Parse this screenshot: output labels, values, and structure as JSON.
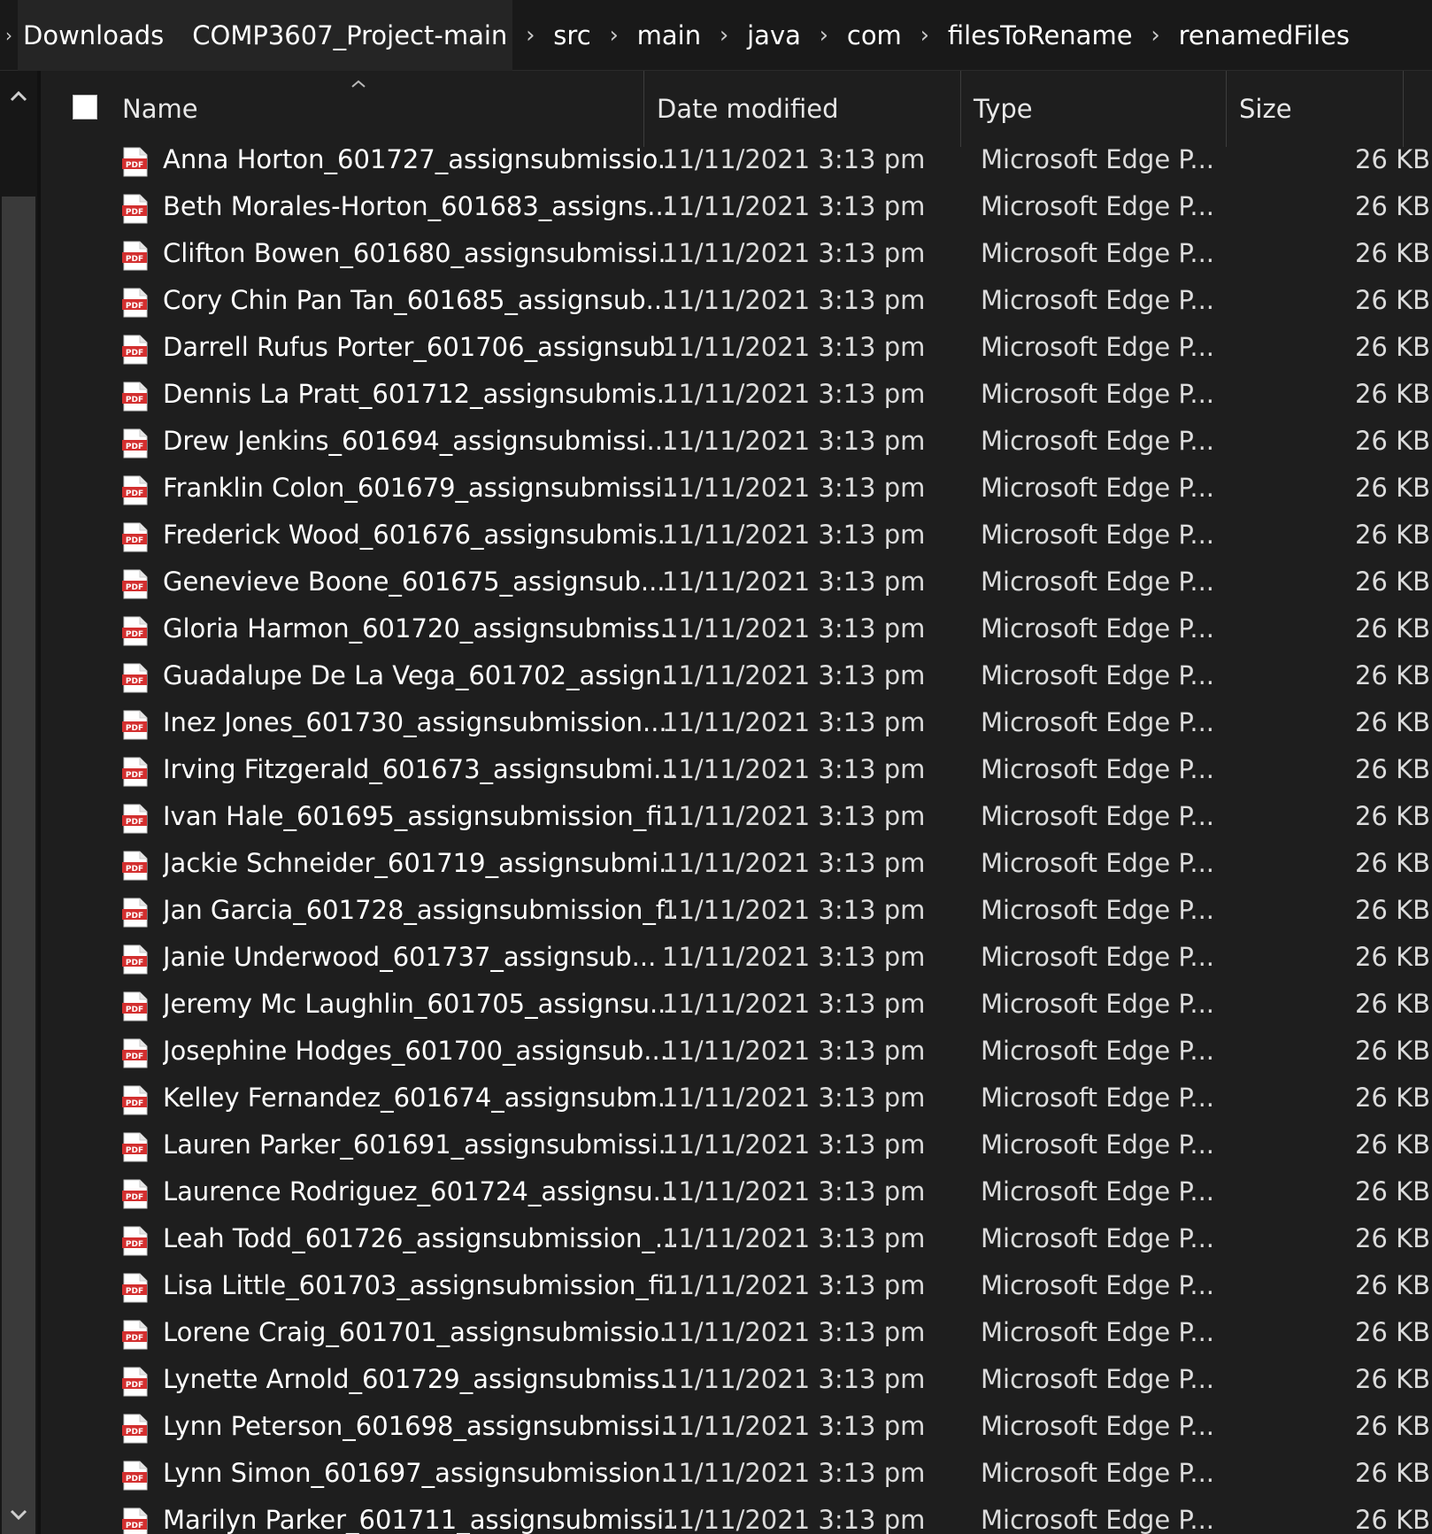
{
  "breadcrumb": [
    "Downloads",
    "COMP3607_Project-main",
    "src",
    "main",
    "java",
    "com",
    "filesToRename",
    "renamedFiles"
  ],
  "breadcrumb_separator": "›",
  "columns": {
    "name": "Name",
    "date": "Date modified",
    "type": "Type",
    "size": "Size"
  },
  "files": [
    {
      "name": "Anna Horton_601727_assignsubmissio...",
      "date": "11/11/2021 3:13 pm",
      "type": "Microsoft Edge P...",
      "size": "26 KB"
    },
    {
      "name": "Beth Morales-Horton_601683_assigns...",
      "date": "11/11/2021 3:13 pm",
      "type": "Microsoft Edge P...",
      "size": "26 KB"
    },
    {
      "name": "Clifton Bowen_601680_assignsubmissi...",
      "date": "11/11/2021 3:13 pm",
      "type": "Microsoft Edge P...",
      "size": "26 KB"
    },
    {
      "name": "Cory Chin Pan Tan_601685_assignsub...",
      "date": "11/11/2021 3:13 pm",
      "type": "Microsoft Edge P...",
      "size": "26 KB"
    },
    {
      "name": "Darrell Rufus Porter_601706_assignsub...",
      "date": "11/11/2021 3:13 pm",
      "type": "Microsoft Edge P...",
      "size": "26 KB"
    },
    {
      "name": "Dennis La Pratt_601712_assignsubmis...",
      "date": "11/11/2021 3:13 pm",
      "type": "Microsoft Edge P...",
      "size": "26 KB"
    },
    {
      "name": "Drew Jenkins_601694_assignsubmissi...",
      "date": "11/11/2021 3:13 pm",
      "type": "Microsoft Edge P...",
      "size": "26 KB"
    },
    {
      "name": "Franklin Colon_601679_assignsubmissi...",
      "date": "11/11/2021 3:13 pm",
      "type": "Microsoft Edge P...",
      "size": "26 KB"
    },
    {
      "name": "Frederick Wood_601676_assignsubmis...",
      "date": "11/11/2021 3:13 pm",
      "type": "Microsoft Edge P...",
      "size": "26 KB"
    },
    {
      "name": "Genevieve Boone_601675_assignsub...",
      "date": "11/11/2021 3:13 pm",
      "type": "Microsoft Edge P...",
      "size": "26 KB"
    },
    {
      "name": "Gloria Harmon_601720_assignsubmiss...",
      "date": "11/11/2021 3:13 pm",
      "type": "Microsoft Edge P...",
      "size": "26 KB"
    },
    {
      "name": "Guadalupe De La Vega_601702_assign...",
      "date": "11/11/2021 3:13 pm",
      "type": "Microsoft Edge P...",
      "size": "26 KB"
    },
    {
      "name": "Inez  Jones_601730_assignsubmission...",
      "date": "11/11/2021 3:13 pm",
      "type": "Microsoft Edge P...",
      "size": "26 KB"
    },
    {
      "name": "Irving Fitzgerald_601673_assignsubmi...",
      "date": "11/11/2021 3:13 pm",
      "type": "Microsoft Edge P...",
      "size": "26 KB"
    },
    {
      "name": "Ivan Hale_601695_assignsubmission_fi...",
      "date": "11/11/2021 3:13 pm",
      "type": "Microsoft Edge P...",
      "size": "26 KB"
    },
    {
      "name": "Jackie Schneider_601719_assignsubmi...",
      "date": "11/11/2021 3:13 pm",
      "type": "Microsoft Edge P...",
      "size": "26 KB"
    },
    {
      "name": "Jan Garcia_601728_assignsubmission_f...",
      "date": "11/11/2021 3:13 pm",
      "type": "Microsoft Edge P...",
      "size": "26 KB"
    },
    {
      "name": "Janie Underwood_601737_assignsub...",
      "date": "11/11/2021 3:13 pm",
      "type": "Microsoft Edge P...",
      "size": "26 KB"
    },
    {
      "name": "Jeremy Mc Laughlin_601705_assignsu...",
      "date": "11/11/2021 3:13 pm",
      "type": "Microsoft Edge P...",
      "size": "26 KB"
    },
    {
      "name": "Josephine Hodges_601700_assignsub...",
      "date": "11/11/2021 3:13 pm",
      "type": "Microsoft Edge P...",
      "size": "26 KB"
    },
    {
      "name": "Kelley Fernandez_601674_assignsubm...",
      "date": "11/11/2021 3:13 pm",
      "type": "Microsoft Edge P...",
      "size": "26 KB"
    },
    {
      "name": "Lauren Parker_601691_assignsubmissi...",
      "date": "11/11/2021 3:13 pm",
      "type": "Microsoft Edge P...",
      "size": "26 KB"
    },
    {
      "name": "Laurence Rodriguez_601724_assignsu...",
      "date": "11/11/2021 3:13 pm",
      "type": "Microsoft Edge P...",
      "size": "26 KB"
    },
    {
      "name": "Leah Todd_601726_assignsubmission_...",
      "date": "11/11/2021 3:13 pm",
      "type": "Microsoft Edge P...",
      "size": "26 KB"
    },
    {
      "name": "Lisa Little_601703_assignsubmission_fi...",
      "date": "11/11/2021 3:13 pm",
      "type": "Microsoft Edge P...",
      "size": "26 KB"
    },
    {
      "name": "Lorene Craig_601701_assignsubmissio...",
      "date": "11/11/2021 3:13 pm",
      "type": "Microsoft Edge P...",
      "size": "26 KB"
    },
    {
      "name": "Lynette Arnold_601729_assignsubmiss...",
      "date": "11/11/2021 3:13 pm",
      "type": "Microsoft Edge P...",
      "size": "26 KB"
    },
    {
      "name": "Lynn Peterson_601698_assignsubmissi...",
      "date": "11/11/2021 3:13 pm",
      "type": "Microsoft Edge P...",
      "size": "26 KB"
    },
    {
      "name": "Lynn Simon_601697_assignsubmission...",
      "date": "11/11/2021 3:13 pm",
      "type": "Microsoft Edge P...",
      "size": "26 KB"
    },
    {
      "name": "Marilyn Parker_601711_assignsubmissi...",
      "date": "11/11/2021 3:13 pm",
      "type": "Microsoft Edge P...",
      "size": "26 KB"
    }
  ],
  "icons": {
    "file": "pdf-file-icon",
    "scroll_up": "chevron-up-icon",
    "scroll_down": "chevron-down-icon",
    "sort": "sort-ascending-icon"
  },
  "colors": {
    "background": "#1e1e1e",
    "pdf_red": "#d32f2f"
  }
}
